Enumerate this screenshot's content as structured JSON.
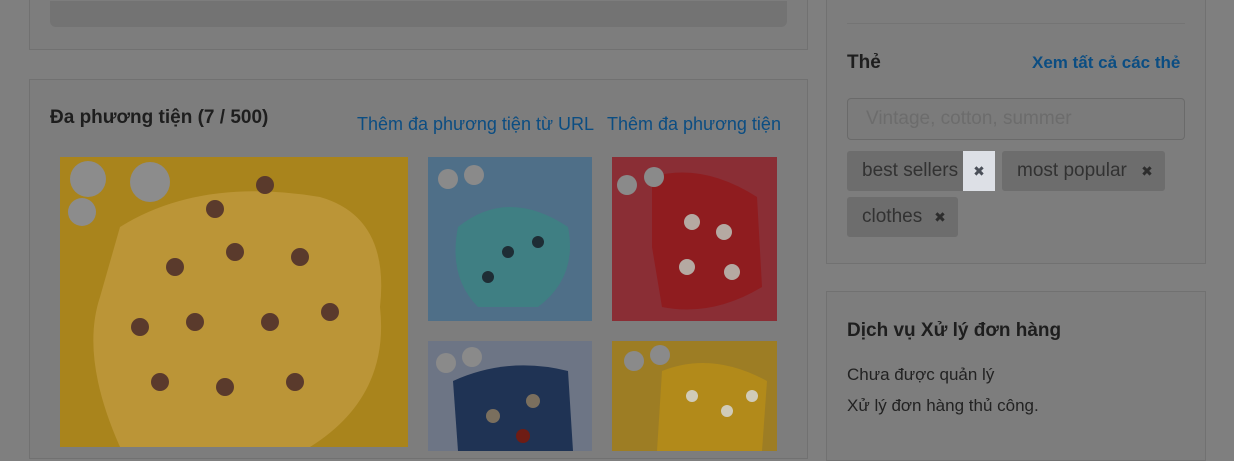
{
  "media": {
    "title": "Đa phương tiện (7 / 500)",
    "add_from_url": "Thêm đa phương tiện từ URL",
    "add_media": "Thêm đa phương tiện"
  },
  "tags": {
    "title": "Thẻ",
    "view_all": "Xem tất cả các thẻ",
    "input_placeholder": "Vintage, cotton, summer",
    "items": [
      {
        "label": "best sellers"
      },
      {
        "label": "most popular"
      },
      {
        "label": "clothes"
      }
    ]
  },
  "fulfillment": {
    "title": "Dịch vụ Xử lý đơn hàng",
    "line1": "Chưa được quản lý",
    "line2": "Xử lý đơn hàng thủ công."
  },
  "colors": {
    "overlay": "#7f7f7f",
    "link": "#0b4d82",
    "highlight": "#dde0e6",
    "sweater_yellow": "#b28a1a",
    "sweater_mint": "#3f7f83",
    "sweater_red": "#8f1c1f",
    "sweater_navy": "#1f3354"
  },
  "icons": {
    "tag_remove": "close-icon"
  }
}
